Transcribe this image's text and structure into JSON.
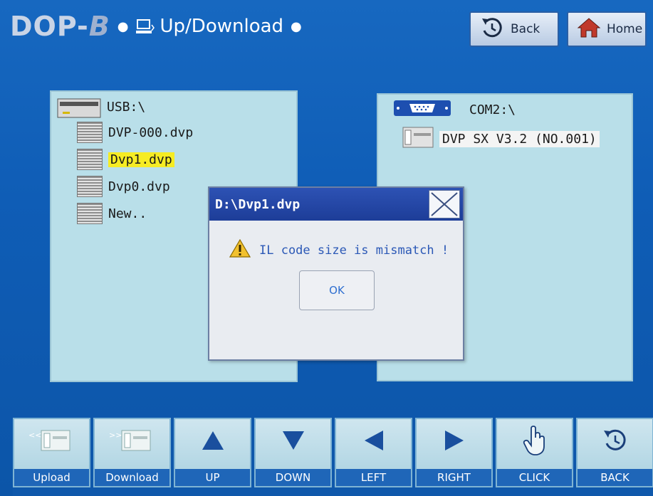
{
  "header": {
    "brand_prefix": "DOP-",
    "brand_suffix": "B",
    "title": "Up/Download",
    "back_label": "Back",
    "home_label": "Home"
  },
  "left_panel": {
    "root": "USB:\\",
    "files": [
      "DVP-000.dvp",
      "Dvp1.dvp",
      "Dvp0.dvp",
      "New.."
    ],
    "selected_index": 1
  },
  "right_panel": {
    "root": "COM2:\\",
    "device": "DVP SX V3.2 (NO.001)"
  },
  "dialog": {
    "title": "D:\\Dvp1.dvp",
    "message": "IL code size is mismatch !",
    "ok_label": "OK"
  },
  "toolbar": {
    "buttons": [
      {
        "label": "Upload",
        "icon": "upload-icon"
      },
      {
        "label": "Download",
        "icon": "download-icon"
      },
      {
        "label": "UP",
        "icon": "arrow-up-icon"
      },
      {
        "label": "DOWN",
        "icon": "arrow-down-icon"
      },
      {
        "label": "LEFT",
        "icon": "arrow-left-icon"
      },
      {
        "label": "RIGHT",
        "icon": "arrow-right-icon"
      },
      {
        "label": "CLICK",
        "icon": "hand-pointer-icon"
      },
      {
        "label": "BACK",
        "icon": "back-arrow-icon"
      }
    ]
  },
  "colors": {
    "background": "#0f5db6",
    "panel": "#b9dfe9",
    "selection": "#f6ec24",
    "dialog_title": "#1d3d98"
  }
}
